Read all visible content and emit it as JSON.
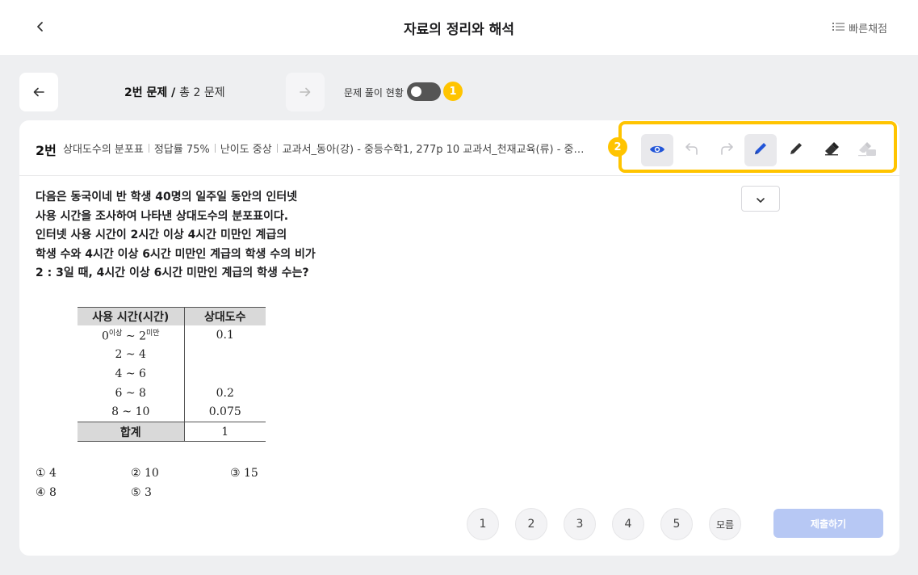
{
  "header": {
    "title": "자료의 정리와 해석",
    "quick_grade_label": "빠른채점"
  },
  "navigation": {
    "counter_current": "2번 문제",
    "counter_sep": " / ",
    "counter_total": "총 2 문제",
    "status_label": "문제 풀이 현황",
    "status_toggle_on": false
  },
  "badges": {
    "badge1": "1",
    "badge2": "2"
  },
  "question_header": {
    "number": "2번",
    "meta": [
      "상대도수의 분포표",
      "정답률 75%",
      "난이도 중상",
      "교과서_동아(강) - 중등수학1, 277p 10 교과서_천재교육(류) - 중…"
    ]
  },
  "toolbar": {
    "tools": [
      "eye-icon",
      "undo-icon",
      "redo-icon",
      "pen-blue-icon",
      "pen-black-icon",
      "eraser-icon",
      "clear-all-icon"
    ],
    "active": [
      "eye-icon",
      "pen-blue-icon"
    ]
  },
  "question": {
    "lines": [
      "다음은 동국이네 반 학생 40명의 일주일 동안의 인터넷",
      "사용 시간을 조사하여 나타낸 상대도수의 분포표이다.",
      "인터넷 사용 시간이 2시간 이상 4시간 미만인 계급의",
      "학생 수와 4시간 이상 6시간 미만인 계급의 학생 수의 비가",
      "2 : 3일 때, 4시간 이상 6시간 미만인 계급의 학생 수는?"
    ]
  },
  "table": {
    "headers": [
      "사용 시간(시간)",
      "상대도수"
    ],
    "first_row": {
      "from": "0",
      "from_sup": "이상",
      "sep": " ~ ",
      "to": "2",
      "to_sup": "미만",
      "value": "0.1"
    },
    "rows": [
      {
        "range": "2 ~ 4",
        "value": ""
      },
      {
        "range": "4 ~ 6",
        "value": ""
      },
      {
        "range": "6 ~ 8",
        "value": "0.2"
      },
      {
        "range": "8 ~ 10",
        "value": "0.075"
      }
    ],
    "total_label": "합계",
    "total_value": "1"
  },
  "choices": [
    "① 4",
    "② 10",
    "③ 15",
    "④ 8",
    "⑤ 3"
  ],
  "answer_buttons": [
    "1",
    "2",
    "3",
    "4",
    "5",
    "모름"
  ],
  "submit_label": "제출하기"
}
